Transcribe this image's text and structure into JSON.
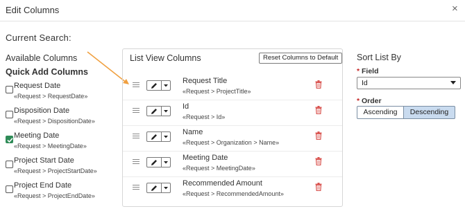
{
  "dialog": {
    "title": "Edit Columns",
    "close_glyph": "×"
  },
  "current_search": {
    "label": "Current Search:"
  },
  "available": {
    "title": "Available Columns",
    "quick_title": "Quick Add Columns",
    "items": [
      {
        "label": "Request Date",
        "path": "«Request > RequestDate»",
        "checked": false
      },
      {
        "label": "Disposition Date",
        "path": "«Request > DispositionDate»",
        "checked": false
      },
      {
        "label": "Meeting Date",
        "path": "«Request > MeetingDate»",
        "checked": true
      },
      {
        "label": "Project Start Date",
        "path": "«Request > ProjectStartDate»",
        "checked": false
      },
      {
        "label": "Project End Date",
        "path": "«Request > ProjectEndDate»",
        "checked": false
      }
    ]
  },
  "list_view": {
    "title": "List View Columns",
    "reset_label": "Reset Columns to Default",
    "columns": [
      {
        "name": "Request Title",
        "path": "«Request > ProjectTitle»"
      },
      {
        "name": "Id",
        "path": "«Request > Id»"
      },
      {
        "name": "Name",
        "path": "«Request > Organization > Name»"
      },
      {
        "name": "Meeting Date",
        "path": "«Request > MeetingDate»"
      },
      {
        "name": "Recommended Amount",
        "path": "«Request > RecommendedAmount»"
      }
    ]
  },
  "sort": {
    "title": "Sort List By",
    "required_mark": "*",
    "field_label": "Field",
    "field_value": "Id",
    "order_label": "Order",
    "asc_label": "Ascending",
    "desc_label": "Descending",
    "selected_order": "Descending"
  },
  "colors": {
    "accent_arrow": "#f0a040",
    "checkbox_checked": "#2e8b57",
    "trash_icon": "#d9534f",
    "selected_segment": "#c9dbef",
    "required_asterisk": "#c62828"
  },
  "icons": {
    "close": "close-icon",
    "drag": "drag-handle-icon",
    "edit": "pencil-icon",
    "dropdown": "caret-down-icon",
    "delete": "trash-icon",
    "check": "checkmark-icon"
  }
}
